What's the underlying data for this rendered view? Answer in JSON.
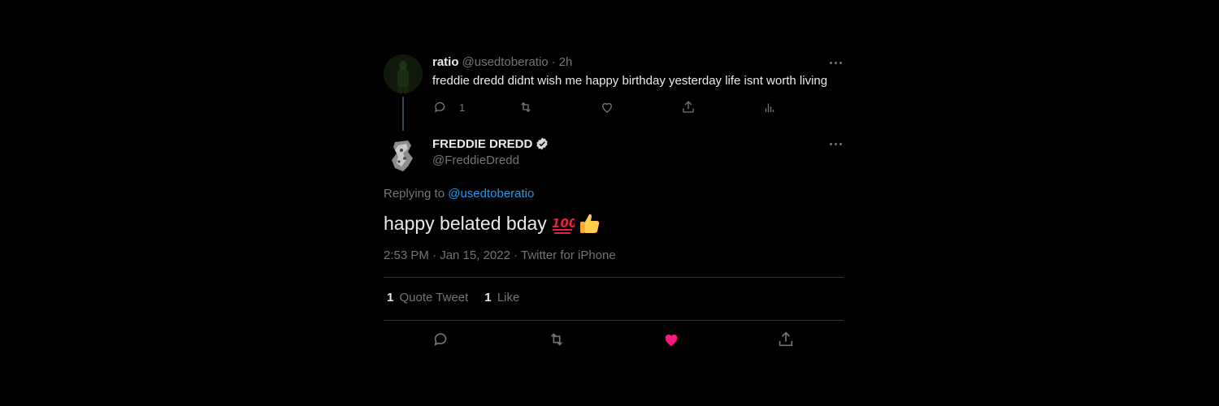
{
  "parent_tweet": {
    "author_name": "ratio",
    "handle": "@usedtoberatio",
    "separator": "·",
    "time_ago": "2h",
    "text": "freddie dredd didnt wish me happy birthday yesterday life isnt worth living",
    "reply_count": "1"
  },
  "main_tweet": {
    "author_name": "FREDDIE DREDD",
    "handle": "@FreddieDredd",
    "replying_to_label": "Replying to",
    "replying_to_handle": "@usedtoberatio",
    "text": "happy belated bday",
    "emojis": [
      "hundred-points",
      "thumbs-up"
    ],
    "timestamp": "2:53 PM · Jan 15, 2022 · Twitter for iPhone",
    "stats": [
      {
        "count": "1",
        "label": "Quote Tweet"
      },
      {
        "count": "1",
        "label": "Like"
      }
    ],
    "liked": true
  },
  "colors": {
    "background": "#000000",
    "accent_link": "#1d9bf0",
    "like_active": "#f91880",
    "muted_text": "#71767b",
    "divider": "#2f3336"
  },
  "icons": [
    "reply-icon",
    "retweet-icon",
    "like-icon",
    "share-icon",
    "analytics-icon",
    "more-icon",
    "verified-badge-icon"
  ]
}
